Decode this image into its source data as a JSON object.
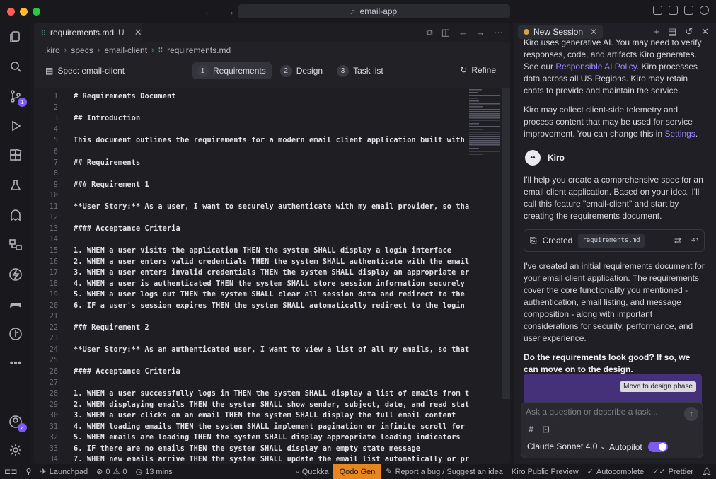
{
  "titlebar": {
    "search_text": "email-app"
  },
  "activity": {
    "scm_badge": "1"
  },
  "editor": {
    "tab": {
      "filename": "requirements.md",
      "modified": "U"
    },
    "breadcrumb": [
      ".kiro",
      "specs",
      "email-client",
      "requirements.md"
    ],
    "spec_label": "Spec: email-client",
    "steps": [
      {
        "num": "1",
        "label": "Requirements"
      },
      {
        "num": "2",
        "label": "Design"
      },
      {
        "num": "3",
        "label": "Task list"
      }
    ],
    "refine_label": "Refine",
    "lines": [
      {
        "n": "1",
        "t": "# Requirements Document"
      },
      {
        "n": "2",
        "t": ""
      },
      {
        "n": "3",
        "t": "## Introduction"
      },
      {
        "n": "4",
        "t": ""
      },
      {
        "n": "5",
        "t": "This document outlines the requirements for a modern email client application built with"
      },
      {
        "n": "6",
        "t": ""
      },
      {
        "n": "7",
        "t": "## Requirements"
      },
      {
        "n": "8",
        "t": ""
      },
      {
        "n": "9",
        "t": "### Requirement 1"
      },
      {
        "n": "10",
        "t": ""
      },
      {
        "n": "11",
        "t": "**User Story:** As a user, I want to securely authenticate with my email provider, so tha"
      },
      {
        "n": "12",
        "t": ""
      },
      {
        "n": "13",
        "t": "#### Acceptance Criteria"
      },
      {
        "n": "14",
        "t": ""
      },
      {
        "n": "15",
        "t": "1. WHEN a user visits the application THEN the system SHALL display a login interface"
      },
      {
        "n": "16",
        "t": "2. WHEN a user enters valid credentials THEN the system SHALL authenticate with the email"
      },
      {
        "n": "17",
        "t": "3. WHEN a user enters invalid credentials THEN the system SHALL display an appropriate er"
      },
      {
        "n": "18",
        "t": "4. WHEN a user is authenticated THEN the system SHALL store session information securely"
      },
      {
        "n": "19",
        "t": "5. WHEN a user logs out THEN the system SHALL clear all session data and redirect to the"
      },
      {
        "n": "20",
        "t": "6. IF a user's session expires THEN the system SHALL automatically redirect to the login"
      },
      {
        "n": "21",
        "t": ""
      },
      {
        "n": "22",
        "t": "### Requirement 2"
      },
      {
        "n": "23",
        "t": ""
      },
      {
        "n": "24",
        "t": "**User Story:** As an authenticated user, I want to view a list of all my emails, so that"
      },
      {
        "n": "25",
        "t": ""
      },
      {
        "n": "26",
        "t": "#### Acceptance Criteria"
      },
      {
        "n": "27",
        "t": ""
      },
      {
        "n": "28",
        "t": "1. WHEN a user successfully logs in THEN the system SHALL display a list of emails from t"
      },
      {
        "n": "29",
        "t": "2. WHEN displaying emails THEN the system SHALL show sender, subject, date, and read stat"
      },
      {
        "n": "30",
        "t": "3. WHEN a user clicks on an email THEN the system SHALL display the full email content"
      },
      {
        "n": "31",
        "t": "4. WHEN loading emails THEN the system SHALL implement pagination or infinite scroll for"
      },
      {
        "n": "32",
        "t": "5. WHEN emails are loading THEN the system SHALL display appropriate loading indicators"
      },
      {
        "n": "33",
        "t": "6. IF there are no emails THEN the system SHALL display an empty state message"
      },
      {
        "n": "34",
        "t": "7. WHEN new emails arrive THEN the system SHALL update the email list automatically or pr"
      }
    ]
  },
  "chat": {
    "tab_label": "New Session",
    "intro_1a": "Kiro uses generative AI. You may need to verify responses, code, and artifacts Kiro generates. See our ",
    "intro_1_link": "Responsible AI Policy",
    "intro_1b": ". Kiro processes data across all US Regions. Kiro may retain chats to provide and maintain the service.",
    "intro_2a": "Kiro may collect client-side telemetry and process content that may be used for service improvement. You can change this in ",
    "intro_2_link": "Settings",
    "intro_2b": ".",
    "agent_name": "Kiro",
    "msg_1": "I'll help you create a comprehensive spec for an email client application. Based on your idea, I'll call this feature \"email-client\" and start by creating the requirements document.",
    "created_label": "Created",
    "created_file": "requirements.md",
    "msg_2": "I've created an initial requirements document for your email client application. The requirements cover the core functionality you mentioned - authentication, email listing, and message composition - along with important considerations for security, performance, and user experience.",
    "msg_question": "Do the requirements look good? If so, we can move on to the design.",
    "move_button": "Move to design phase",
    "input_placeholder": "Ask a question or describe a task...",
    "model": "Claude Sonnet 4.0",
    "autopilot": "Autopilot"
  },
  "statusbar": {
    "launchpad": "Launchpad",
    "errors": "0",
    "warnings": "0",
    "time": "13 mins",
    "quokka": "Quokka",
    "qodo": "Qodo Gen",
    "report": "Report a bug / Suggest an idea",
    "preview": "Kiro Public Preview",
    "autocomplete": "Autocomplete",
    "prettier": "Prettier"
  },
  "colors": {
    "accent": "#7c5cf0",
    "qodo": "#e8851f",
    "link": "#9f86ff"
  }
}
